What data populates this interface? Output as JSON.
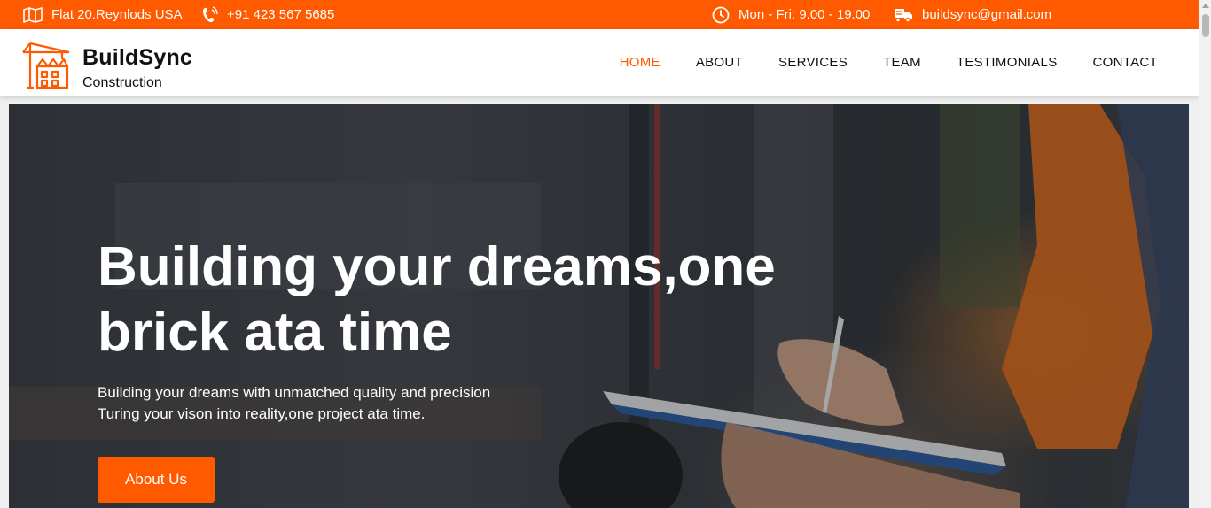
{
  "topbar": {
    "address": "Flat 20.Reynlods USA",
    "phone": "+91 423 567 5685",
    "hours": "Mon - Fri: 9.00 - 19.00",
    "email": "buildsync@gmail.com",
    "background": "#ff5a00"
  },
  "brand": {
    "name": "BuildSync",
    "subtitle": "Construction",
    "accent": "#ff5a00"
  },
  "nav": {
    "items": [
      {
        "label": "HOME",
        "active": true
      },
      {
        "label": "ABOUT"
      },
      {
        "label": "SERVICES"
      },
      {
        "label": "TEAM"
      },
      {
        "label": "TESTIMONIALS"
      },
      {
        "label": "CONTACT"
      }
    ]
  },
  "hero": {
    "title": "Building your dreams,one brick ata time",
    "line1": "Building your dreams with unmatched quality and precision",
    "line2": "Turing your vison into reality,one project ata time.",
    "button_label": "About Us"
  },
  "icons": {
    "address": "map-icon",
    "phone": "phone-icon",
    "hours": "clock-icon",
    "email": "truck-mail-icon",
    "brand": "construction-crane-icon"
  }
}
